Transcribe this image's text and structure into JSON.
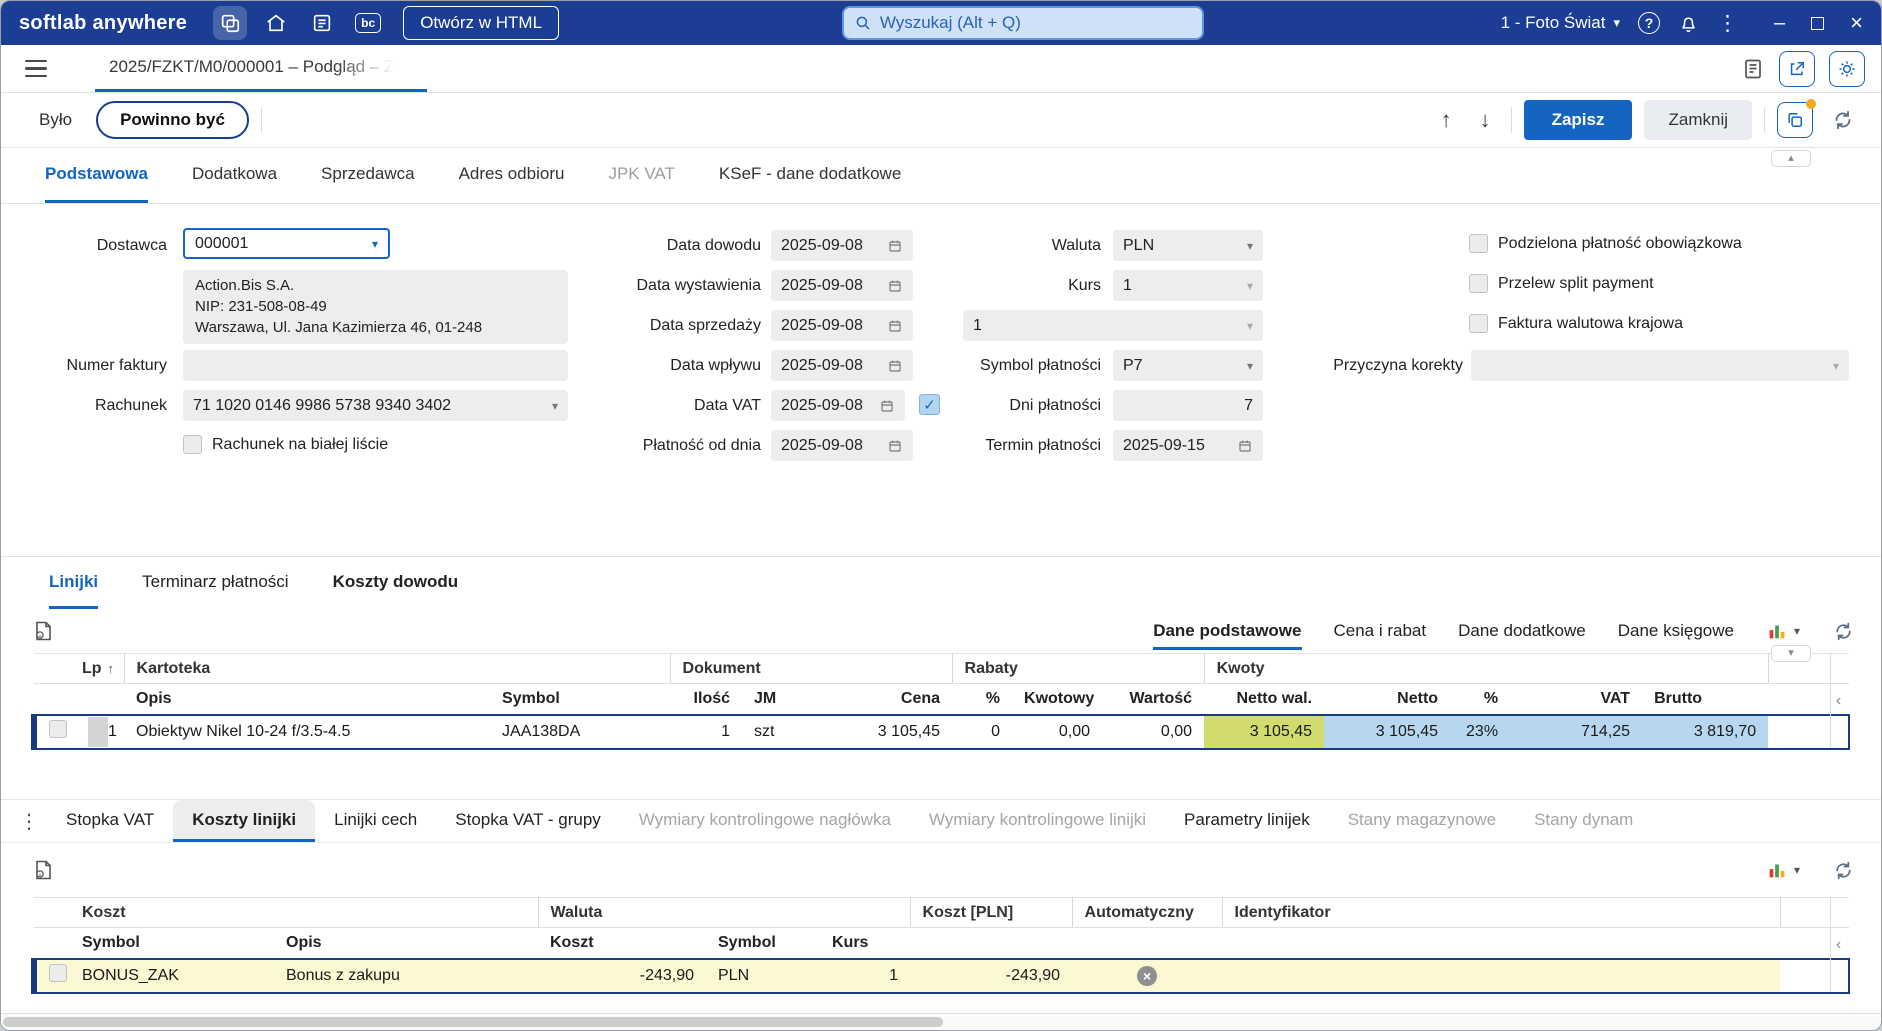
{
  "topbar": {
    "brand": "softlab anywhere",
    "bc_label": "bc",
    "open_html_button": "Otwórz w HTML",
    "search_placeholder": "Wyszukaj (Alt + Q)",
    "company": "1 - Foto Świat"
  },
  "tabbar": {
    "document_tab": "2025/FZKT/M0/000001 – Podgląd – Z"
  },
  "toolbar": {
    "bylo": "Było",
    "powinno_byc": "Powinno być",
    "zapisz": "Zapisz",
    "zamknij": "Zamknij"
  },
  "form_tabs": [
    "Podstawowa",
    "Dodatkowa",
    "Sprzedawca",
    "Adres odbioru",
    "JPK VAT",
    "KSeF - dane dodatkowe"
  ],
  "form": {
    "dostawca_label": "Dostawca",
    "dostawca_value": "000001",
    "dostawca_details_1": "Action.Bis S.A.",
    "dostawca_details_2": "NIP: 231-508-08-49",
    "dostawca_details_3": "Warszawa, Ul. Jana Kazimierza 46, 01-248",
    "numer_faktury_label": "Numer faktury",
    "rachunek_label": "Rachunek",
    "rachunek_value": "71 1020 0146 9986 5738 9340 3402",
    "rachunek_checkbox_label": "Rachunek na białej liście",
    "dates": [
      {
        "label": "Data dowodu",
        "value": "2025-09-08"
      },
      {
        "label": "Data wystawienia",
        "value": "2025-09-08"
      },
      {
        "label": "Data sprzedaży",
        "value": "2025-09-08"
      },
      {
        "label": "Data wpływu",
        "value": "2025-09-08"
      },
      {
        "label": "Data VAT",
        "value": "2025-09-08"
      },
      {
        "label": "Płatność od dnia",
        "value": "2025-09-08"
      }
    ],
    "waluta_label": "Waluta",
    "waluta_value": "PLN",
    "kurs_label": "Kurs",
    "kurs_value": "1",
    "kurs2_value": "1",
    "symbol_platnosci_label": "Symbol płatności",
    "symbol_platnosci_value": "P7",
    "dni_platnosci_label": "Dni płatności",
    "dni_platnosci_value": "7",
    "termin_platnosci_label": "Termin płatności",
    "termin_platnosci_value": "2025-09-15",
    "checkboxes": [
      "Podzielona płatność obowiązkowa",
      "Przelew split payment",
      "Faktura walutowa krajowa"
    ],
    "przyczyna_korekty_label": "Przyczyna korekty"
  },
  "lines_tabs": [
    "Linijki",
    "Terminarz płatności",
    "Koszty dowodu"
  ],
  "data_tabs": [
    "Dane podstawowe",
    "Cena i rabat",
    "Dane dodatkowe",
    "Dane księgowe"
  ],
  "lines_table": {
    "groups": [
      "Lp",
      "Kartoteka",
      "Dokument",
      "Rabaty",
      "Kwoty"
    ],
    "columns": [
      "Opis",
      "Symbol",
      "Ilość",
      "JM",
      "Cena",
      "%",
      "Kwotowy",
      "Wartość",
      "Netto wal.",
      "Netto",
      "%",
      "VAT",
      "Brutto"
    ],
    "row": {
      "lp": "1",
      "opis": "Obiektyw Nikel 10-24 f/3.5-4.5",
      "symbol": "JAA138DA",
      "ilosc": "1",
      "jm": "szt",
      "cena": "3 105,45",
      "rabat_proc": "0",
      "rabat_kwotowy": "0,00",
      "rabat_wartosc": "0,00",
      "netto_wal": "3 105,45",
      "netto": "3 105,45",
      "vat_proc": "23%",
      "vat": "714,25",
      "brutto": "3 819,70"
    }
  },
  "bottom_tabs": [
    "Stopka VAT",
    "Koszty linijki",
    "Linijki cech",
    "Stopka VAT - grupy",
    "Wymiary kontrolingowe nagłówka",
    "Wymiary kontrolingowe linijki",
    "Parametry linijek",
    "Stany magazynowe",
    "Stany dynam"
  ],
  "costs_table": {
    "groups": [
      "Koszt",
      "Waluta",
      "Koszt [PLN]",
      "Automatyczny",
      "Identyfikator"
    ],
    "columns": [
      "Symbol",
      "Opis",
      "Koszt",
      "Symbol",
      "Kurs"
    ],
    "row": {
      "symbol": "BONUS_ZAK",
      "opis": "Bonus z zakupu",
      "koszt": "-243,90",
      "waluta": "PLN",
      "kurs": "1",
      "koszt_pln": "-243,90"
    }
  },
  "icons": {
    "chevron_down": "▾",
    "chevron_up": "▴",
    "chevron_left": "‹",
    "sort_asc": "↑",
    "nav_up": "↑",
    "nav_down": "↓",
    "minimize": "–",
    "close": "×",
    "kebab": "⋮",
    "help": "?",
    "check": "✓",
    "cancel": "×"
  }
}
